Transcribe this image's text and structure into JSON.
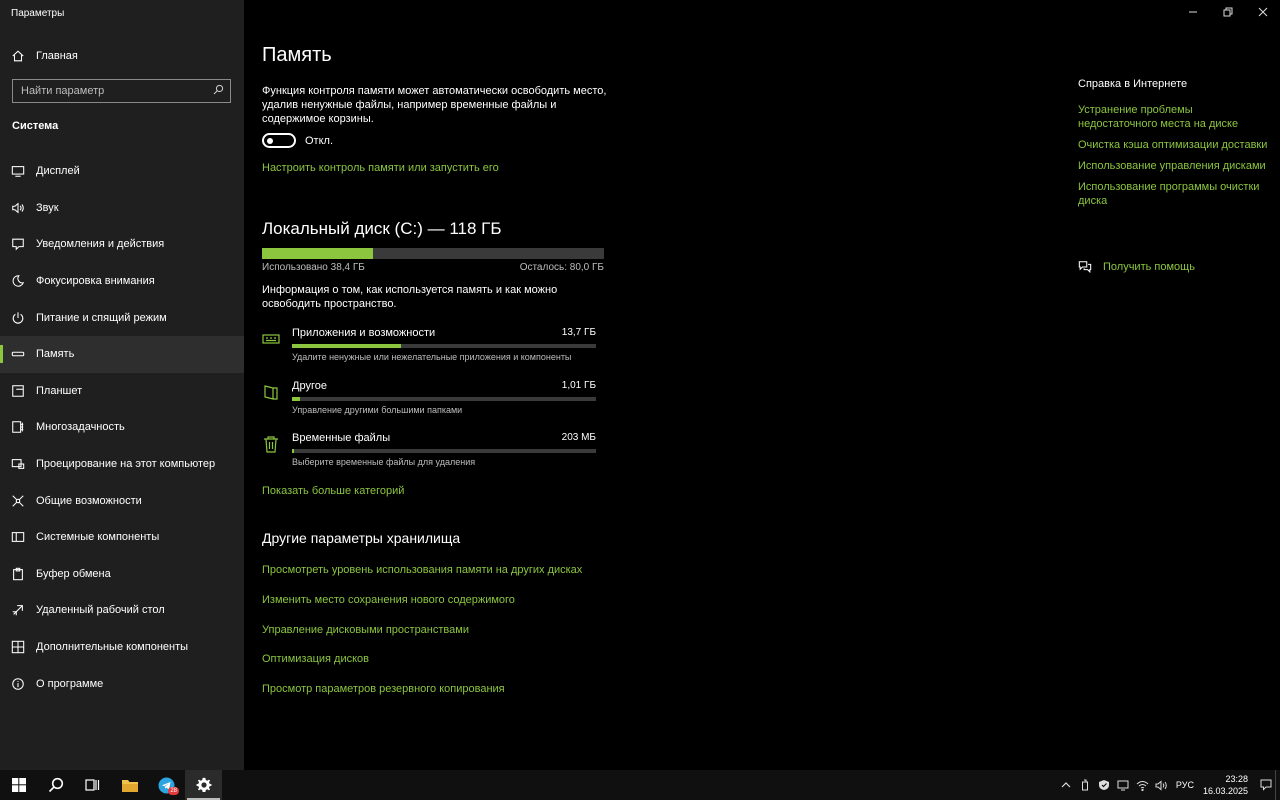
{
  "window": {
    "title": "Параметры"
  },
  "sidebar": {
    "home": "Главная",
    "search_placeholder": "Найти параметр",
    "section": "Система",
    "items": [
      {
        "label": "Дисплей",
        "icon": "monitor-icon"
      },
      {
        "label": "Звук",
        "icon": "speaker-icon"
      },
      {
        "label": "Уведомления и действия",
        "icon": "notification-icon"
      },
      {
        "label": "Фокусировка внимания",
        "icon": "moon-icon"
      },
      {
        "label": "Питание и спящий режим",
        "icon": "power-icon"
      },
      {
        "label": "Память",
        "icon": "storage-icon",
        "active": true
      },
      {
        "label": "Планшет",
        "icon": "tablet-icon"
      },
      {
        "label": "Многозадачность",
        "icon": "multitasking-icon"
      },
      {
        "label": "Проецирование на этот компьютер",
        "icon": "project-icon"
      },
      {
        "label": "Общие возможности",
        "icon": "share-icon"
      },
      {
        "label": "Системные компоненты",
        "icon": "components-icon"
      },
      {
        "label": "Буфер обмена",
        "icon": "clipboard-icon"
      },
      {
        "label": "Удаленный рабочий стол",
        "icon": "remote-desktop-icon"
      },
      {
        "label": "Дополнительные компоненты",
        "icon": "extra-components-icon"
      },
      {
        "label": "О программе",
        "icon": "info-icon"
      }
    ]
  },
  "main": {
    "title": "Память",
    "description": "Функция контроля памяти может автоматически освободить место, удалив ненужные файлы, например временные файлы и содержимое корзины.",
    "toggle_state": "Откл.",
    "configure_link": "Настроить контроль памяти или запустить его",
    "disk": {
      "title": "Локальный диск (C:) — 118 ГБ",
      "used": "Использовано 38,4 ГБ",
      "free": "Осталось: 80,0 ГБ",
      "used_fraction": 0.325
    },
    "info": "Информация о том, как используется память и как можно освободить пространство.",
    "categories": [
      {
        "name": "Приложения и возможности",
        "size": "13,7 ГБ",
        "sub": "Удалите ненужные или нежелательные приложения и компоненты",
        "fraction": 0.36,
        "icon": "apps-icon"
      },
      {
        "name": "Другое",
        "size": "1,01 ГБ",
        "sub": "Управление другими большими папками",
        "fraction": 0.027,
        "icon": "folder-icon"
      },
      {
        "name": "Временные файлы",
        "size": "203 МБ",
        "sub": "Выберите временные файлы для удаления",
        "fraction": 0.006,
        "icon": "trash-icon"
      }
    ],
    "more_link": "Показать больше категорий",
    "other_title": "Другие параметры хранилища",
    "other_links": [
      "Просмотреть уровень использования памяти на других дисках",
      "Изменить место сохранения нового содержимого",
      "Управление дисковыми пространствами",
      "Оптимизация дисков",
      "Просмотр параметров резервного копирования"
    ]
  },
  "help": {
    "title": "Справка в Интернете",
    "links": [
      "Устранение проблемы недостаточного места на диске",
      "Очистка кэша оптимизации доставки",
      "Использование управления дисками",
      "Использование программы очистки диска"
    ],
    "get_help": "Получить помощь"
  },
  "taskbar": {
    "telegram_badge": "28",
    "language": "РУС",
    "time": "23:28",
    "date": "16.03.2025"
  },
  "colors": {
    "accent": "#8cc63f",
    "sidebar": "#1f1f1f",
    "background": "#000000"
  }
}
